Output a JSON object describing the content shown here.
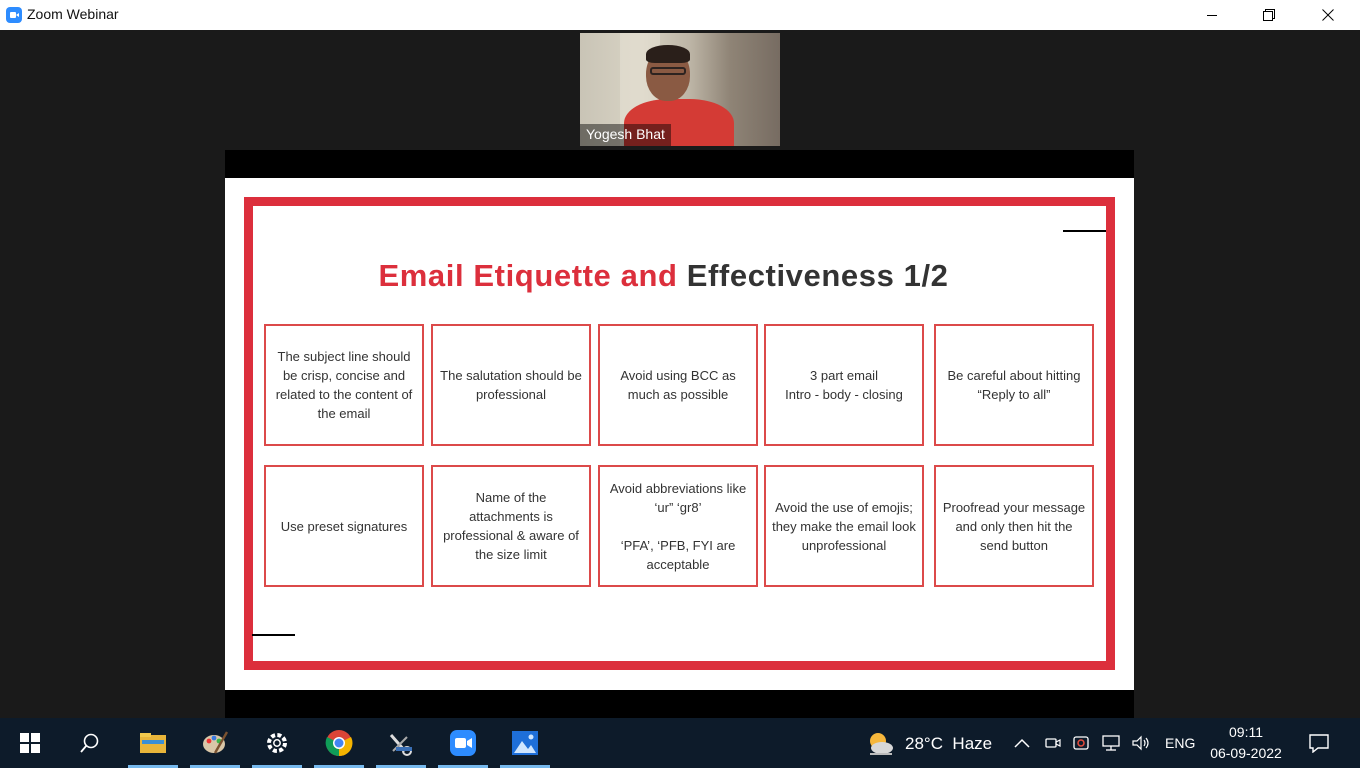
{
  "window": {
    "title": "Zoom Webinar"
  },
  "video": {
    "participant_name": "Yogesh Bhat"
  },
  "slide": {
    "title_red": "Email Etiquette and",
    "title_dark": "Effectiveness 1/2",
    "accent_color": "#dc2f3c",
    "cards": [
      "The subject line should be crisp, concise and related to the content of the email",
      "The salutation should be professional",
      "Avoid using BCC as much as possible",
      "3 part email\nIntro - body - closing",
      "Be careful about hitting “Reply to all”",
      "Use preset signatures",
      "Name of the attachments is professional & aware of the size limit",
      "Avoid abbreviations like ‘ur” ‘gr8’\n\n‘PFA’, ‘PFB, FYI are acceptable",
      "Avoid the use of emojis; they make the email look unprofessional",
      "Proofread your message and only then hit the send button"
    ]
  },
  "taskbar": {
    "apps": [
      "start-icon",
      "search-icon",
      "file-explorer-icon",
      "paint-icon",
      "settings-icon",
      "chrome-icon",
      "snipping-tool-icon",
      "zoom-icon",
      "photos-icon"
    ],
    "weather": "28°C  Haze",
    "language": "ENG",
    "time": "09:11",
    "date": "06-09-2022"
  }
}
